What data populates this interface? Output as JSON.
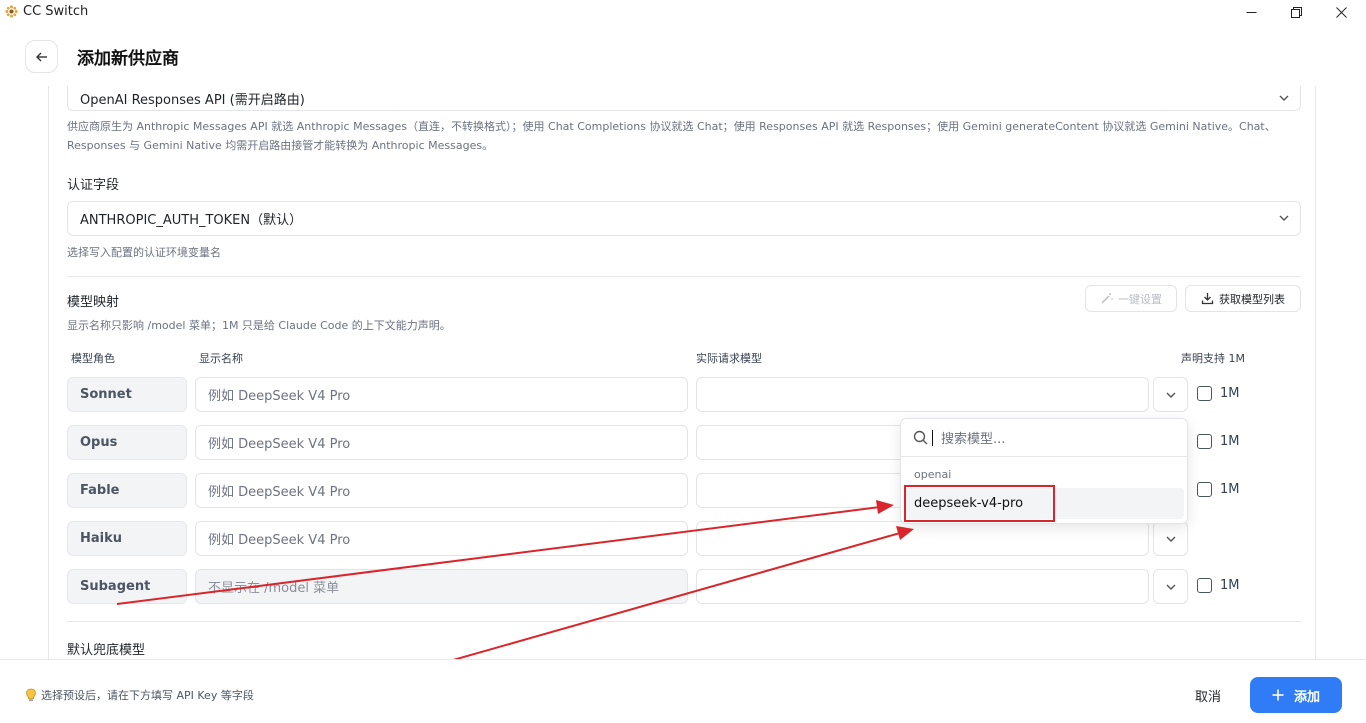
{
  "window": {
    "title": "CC Switch",
    "icon": "sunflower-icon"
  },
  "header": {
    "title": "添加新供应商",
    "back_icon": "arrow-left-icon"
  },
  "api_format": {
    "selected": "OpenAI Responses API (需开启路由)",
    "hint_line1": "供应商原生为 Anthropic Messages API 就选 Anthropic Messages（直连，不转换格式）；使用 Chat Completions 协议就选 Chat；使用 Responses API 就选 Responses；使用 Gemini generateContent 协议就选 Gemini Native。Chat、",
    "hint_line2": "Responses 与 Gemini Native 均需开启路由接管才能转换为 Anthropic Messages。"
  },
  "auth_field": {
    "label": "认证字段",
    "selected": "ANTHROPIC_AUTH_TOKEN（默认）",
    "hint": "选择写入配置的认证环境变量名"
  },
  "model_mapping": {
    "title": "模型映射",
    "hint": "显示名称只影响 /model 菜单；1M 只是给 Claude Code 的上下文能力声明。",
    "one_click_label": "一键设置",
    "fetch_label": "获取模型列表",
    "col_role": "模型角色",
    "col_display": "显示名称",
    "col_actual": "实际请求模型",
    "col_1m": "声明支持 1M",
    "rows": [
      {
        "role": "Sonnet",
        "placeholder": "例如 DeepSeek V4 Pro",
        "actual": "",
        "flag": "1M"
      },
      {
        "role": "Opus",
        "placeholder": "例如 DeepSeek V4 Pro",
        "actual": "",
        "flag": "1M"
      },
      {
        "role": "Fable",
        "placeholder": "例如 DeepSeek V4 Pro",
        "actual": "",
        "flag": "1M"
      },
      {
        "role": "Haiku",
        "placeholder": "例如 DeepSeek V4 Pro",
        "actual": ""
      },
      {
        "role": "Subagent",
        "placeholder": "不显示在 /model 菜单",
        "actual": "",
        "flag": "1M"
      }
    ]
  },
  "model_search": {
    "placeholder": "搜索模型...",
    "group": "openai",
    "items": [
      "deepseek-v4-pro"
    ]
  },
  "fallback": {
    "label": "默认兜底模型"
  },
  "footer": {
    "tip": "选择预设后，请在下方填写 API Key 等字段",
    "cancel_label": "取消",
    "add_label": "添加"
  },
  "colors": {
    "accent": "#2f7cf6",
    "annotation_red": "#d9262c"
  }
}
